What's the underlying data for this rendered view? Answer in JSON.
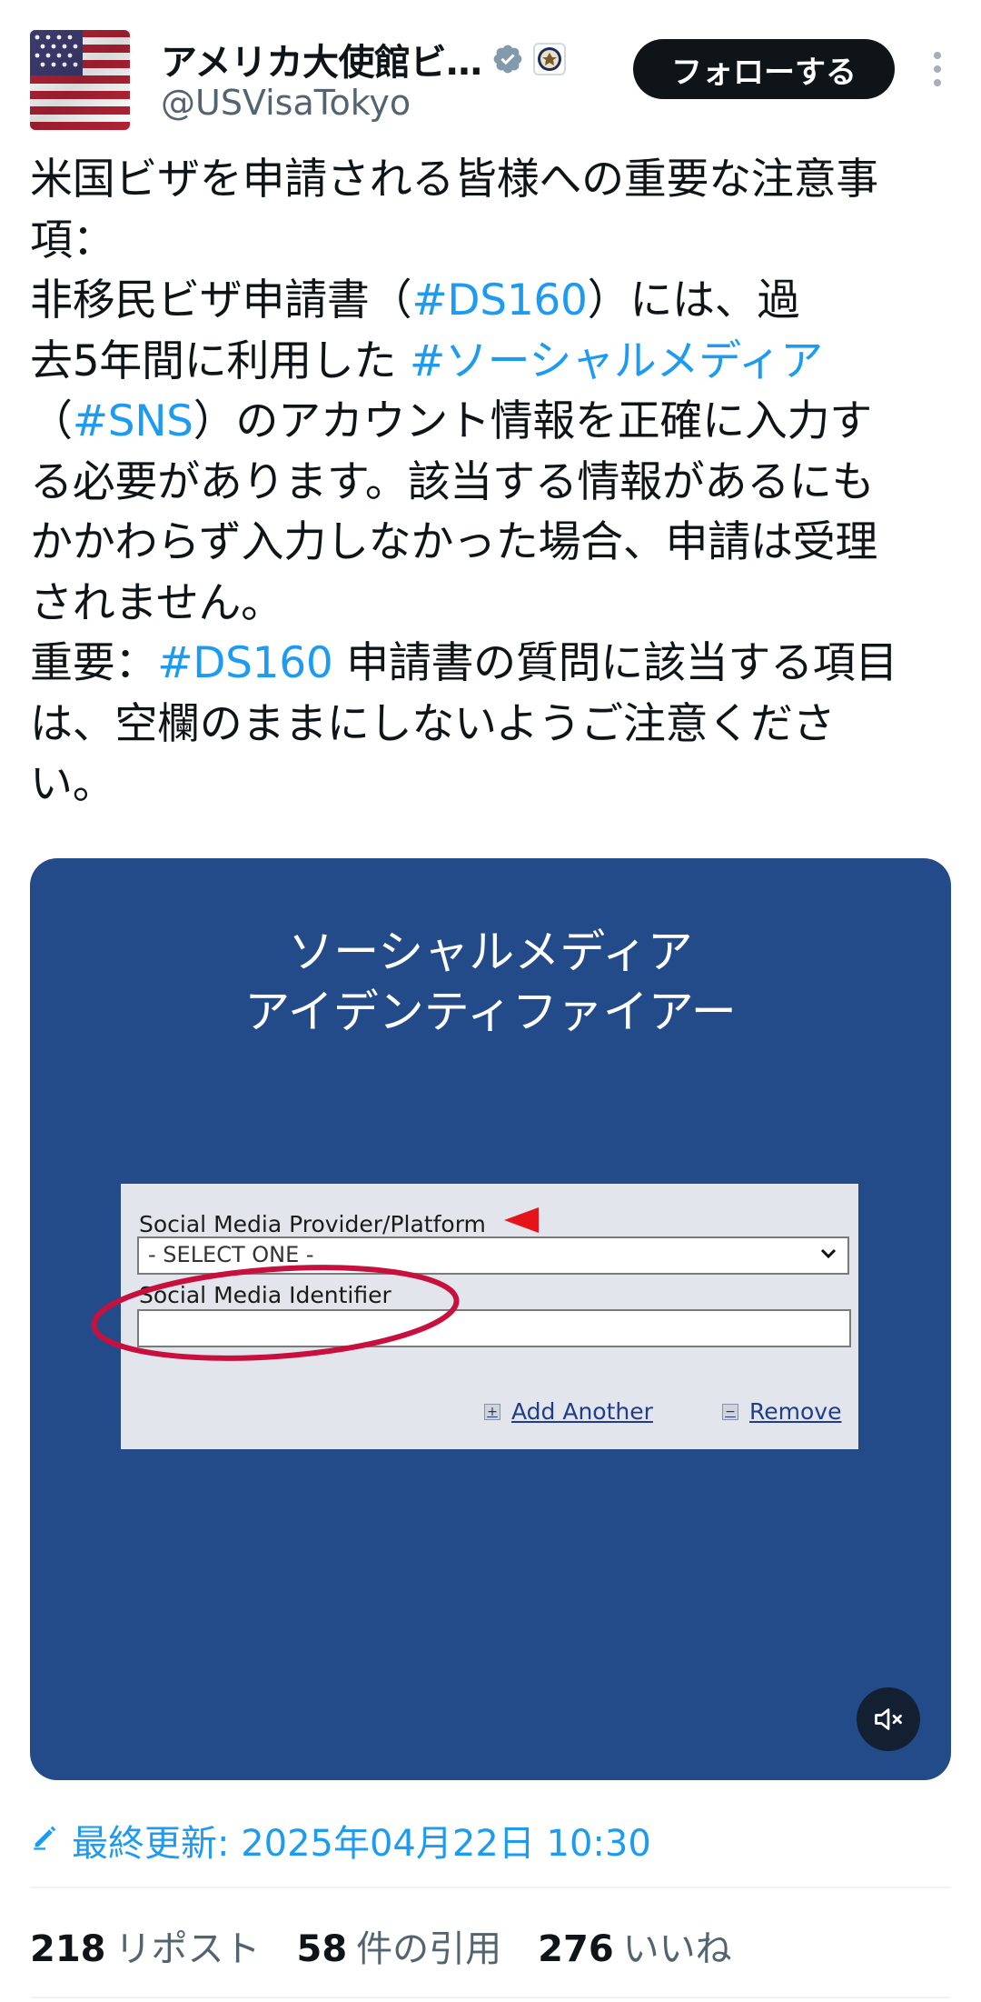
{
  "account": {
    "display_name": "アメリカ大使館ビ…",
    "handle": "@USVisaTokyo",
    "verified_icon": "verified-badge-icon",
    "affiliation_icon": "state-department-seal-icon",
    "follow_label": "フォローする",
    "more_icon": "more-vertical-icon"
  },
  "tweet": {
    "lines": [
      [
        {
          "t": "米国ビザを申請される皆様への重要な注意事"
        }
      ],
      [
        {
          "t": "項："
        }
      ],
      [
        {
          "t": "非移民ビザ申請書（"
        },
        {
          "t": "#DS160",
          "tag": true
        },
        {
          "t": "）には、過"
        }
      ],
      [
        {
          "t": "去5年間に利用した "
        },
        {
          "t": "#ソーシャルメディア",
          "tag": true
        }
      ],
      [
        {
          "t": "（"
        },
        {
          "t": "#SNS",
          "tag": true
        },
        {
          "t": "）のアカウント情報を正確に入力す"
        }
      ],
      [
        {
          "t": "る必要があります。該当する情報があるにも"
        }
      ],
      [
        {
          "t": "かかわらず入力しなかった場合、申請は受理"
        }
      ],
      [
        {
          "t": "されません。"
        }
      ],
      [
        {
          "t": "重要："
        },
        {
          "t": "#DS160",
          "tag": true
        },
        {
          "t": " 申請書の質問に該当する項目"
        }
      ],
      [
        {
          "t": "は、空欄のままにしないようご注意くださ"
        }
      ],
      [
        {
          "t": "い。"
        }
      ]
    ]
  },
  "media": {
    "title_line1": "ソーシャルメディア",
    "title_line2": "アイデンティファイアー",
    "form": {
      "provider_label": "Social Media Provider/Platform",
      "select_value": "- SELECT ONE -",
      "identifier_label": "Social Media Identifier",
      "identifier_value": "",
      "add_label": "Add Another",
      "remove_label": "Remove"
    },
    "mute_icon": "muted-speaker-icon"
  },
  "footer": {
    "updated_icon": "edit-pencil-icon",
    "updated_text": "最終更新: 2025年04月22日 10:30",
    "stats": [
      {
        "count": "218",
        "label": "リポスト"
      },
      {
        "count": "58",
        "label": "件の引用"
      },
      {
        "count": "276",
        "label": "いいね"
      }
    ]
  },
  "colors": {
    "link": "#1d9bf0",
    "media_bg": "#234b89",
    "follow_bg": "#0f1419",
    "highlight_circle": "#c8103e"
  }
}
